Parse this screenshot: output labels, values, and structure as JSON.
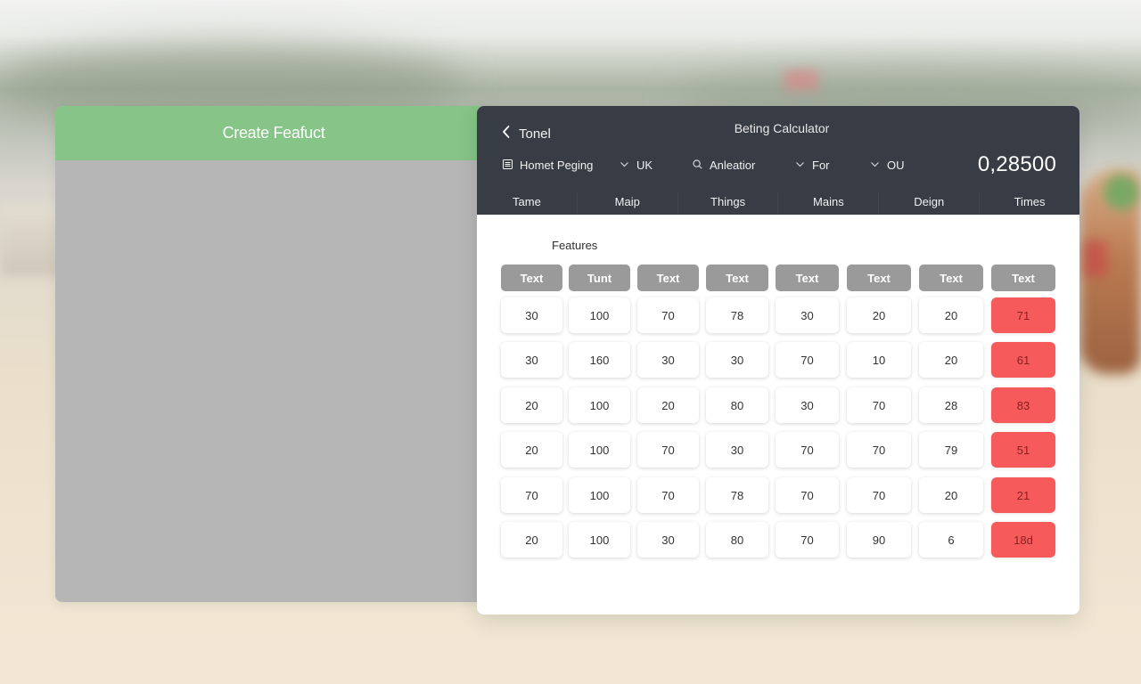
{
  "left_panel": {
    "title": "Create Feafuct"
  },
  "calculator": {
    "back_label": "Tonel",
    "title": "Beting Calculator",
    "odds_value": "0,28500",
    "filters": [
      {
        "label": "Homet Peging",
        "icon": "list-icon"
      },
      {
        "label": "UK",
        "icon": "chevron-down-icon"
      },
      {
        "label": "Anleatior",
        "icon": "search-icon"
      },
      {
        "label": "For",
        "icon": "chevron-down-icon"
      },
      {
        "label": "OU",
        "icon": "chevron-down-icon"
      }
    ],
    "tabs": [
      "Tame",
      "Maip",
      "Things",
      "Mains",
      "Deign",
      "Times"
    ]
  },
  "features": {
    "label": "Features",
    "headers": [
      "Text",
      "Tunt",
      "Text",
      "Text",
      "Text",
      "Text",
      "Text",
      "Text"
    ],
    "rows": [
      [
        "30",
        "100",
        "70",
        "78",
        "30",
        "20",
        "20",
        "71"
      ],
      [
        "30",
        "160",
        "30",
        "30",
        "70",
        "10",
        "20",
        "61"
      ],
      [
        "20",
        "100",
        "20",
        "80",
        "30",
        "70",
        "28",
        "83"
      ],
      [
        "20",
        "100",
        "70",
        "30",
        "70",
        "70",
        "79",
        "51"
      ],
      [
        "70",
        "100",
        "70",
        "78",
        "70",
        "70",
        "20",
        "21"
      ],
      [
        "20",
        "100",
        "30",
        "80",
        "70",
        "90",
        "6",
        "18d"
      ]
    ]
  },
  "colors": {
    "accent_green": "#86c487",
    "header_dark": "#373c45",
    "highlight_red": "#f75a5a",
    "column_header_gray": "#9a9a9a"
  }
}
